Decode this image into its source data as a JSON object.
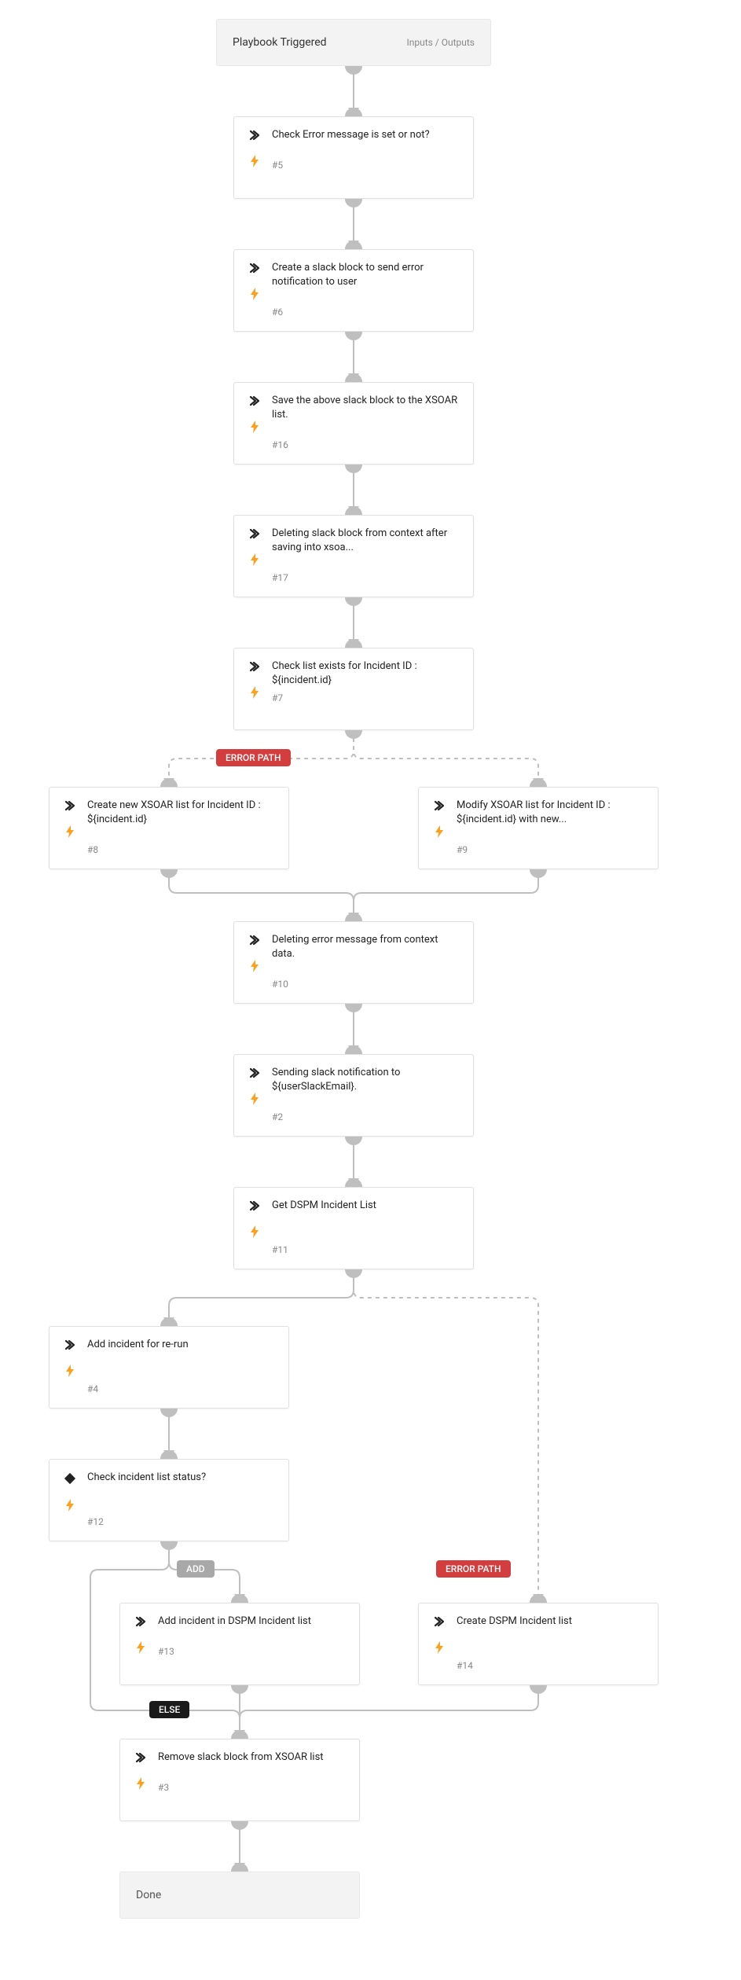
{
  "header": {
    "title": "Playbook Triggered",
    "io": "Inputs / Outputs"
  },
  "labels": {
    "error_path": "ERROR PATH",
    "add": "ADD",
    "else": "ELSE"
  },
  "done": "Done",
  "nodes": {
    "n5": {
      "title": "Check Error message is set or not?",
      "num": "#5"
    },
    "n6": {
      "title": "Create a slack block to send error notification to user",
      "num": "#6"
    },
    "n16": {
      "title": "Save the above slack block to the XSOAR list.",
      "num": "#16"
    },
    "n17": {
      "title": "Deleting slack block from context after saving into xsoa...",
      "num": "#17"
    },
    "n7": {
      "title": "Check list exists for Incident ID : ${incident.id}",
      "num": "#7"
    },
    "n8": {
      "title": "Create new XSOAR list for Incident ID : ${incident.id}",
      "num": "#8"
    },
    "n9": {
      "title": "Modify XSOAR list for Incident ID : ${incident.id} with new...",
      "num": "#9"
    },
    "n10": {
      "title": "Deleting error message from context data.",
      "num": "#10"
    },
    "n2": {
      "title": "Sending slack notification to ${userSlackEmail}.",
      "num": "#2"
    },
    "n11": {
      "title": "Get DSPM Incident List",
      "num": "#11"
    },
    "n4": {
      "title": "Add incident for re-run",
      "num": "#4"
    },
    "n12": {
      "title": "Check incident list status?",
      "num": "#12"
    },
    "n13": {
      "title": "Add incident in DSPM Incident list",
      "num": "#13"
    },
    "n14": {
      "title": "Create DSPM Incident list",
      "num": "#14"
    },
    "n3": {
      "title": "Remove slack block from XSOAR list",
      "num": "#3"
    }
  },
  "chart_data": {
    "type": "flowchart",
    "start": "header",
    "end": "done",
    "nodes": [
      {
        "id": "header",
        "label": "Playbook Triggered",
        "kind": "start"
      },
      {
        "id": "n5",
        "label": "Check Error message is set or not?",
        "task": "#5",
        "kind": "task"
      },
      {
        "id": "n6",
        "label": "Create a slack block to send error notification to user",
        "task": "#6",
        "kind": "task"
      },
      {
        "id": "n16",
        "label": "Save the above slack block to the XSOAR list.",
        "task": "#16",
        "kind": "task"
      },
      {
        "id": "n17",
        "label": "Deleting slack block from context after saving into xsoa...",
        "task": "#17",
        "kind": "task"
      },
      {
        "id": "n7",
        "label": "Check list exists for Incident ID : ${incident.id}",
        "task": "#7",
        "kind": "task"
      },
      {
        "id": "n8",
        "label": "Create new XSOAR list for Incident ID : ${incident.id}",
        "task": "#8",
        "kind": "task"
      },
      {
        "id": "n9",
        "label": "Modify XSOAR list for Incident ID : ${incident.id} with new...",
        "task": "#9",
        "kind": "task"
      },
      {
        "id": "n10",
        "label": "Deleting error message from context data.",
        "task": "#10",
        "kind": "task"
      },
      {
        "id": "n2",
        "label": "Sending slack notification to ${userSlackEmail}.",
        "task": "#2",
        "kind": "task"
      },
      {
        "id": "n11",
        "label": "Get DSPM Incident List",
        "task": "#11",
        "kind": "task"
      },
      {
        "id": "n4",
        "label": "Add incident for re-run",
        "task": "#4",
        "kind": "task"
      },
      {
        "id": "n12",
        "label": "Check incident list status?",
        "task": "#12",
        "kind": "condition"
      },
      {
        "id": "n13",
        "label": "Add incident in DSPM Incident list",
        "task": "#13",
        "kind": "task"
      },
      {
        "id": "n14",
        "label": "Create DSPM Incident list",
        "task": "#14",
        "kind": "task"
      },
      {
        "id": "n3",
        "label": "Remove slack block from XSOAR list",
        "task": "#3",
        "kind": "task"
      },
      {
        "id": "done",
        "label": "Done",
        "kind": "end"
      }
    ],
    "edges": [
      {
        "from": "header",
        "to": "n5"
      },
      {
        "from": "n5",
        "to": "n6"
      },
      {
        "from": "n6",
        "to": "n16"
      },
      {
        "from": "n16",
        "to": "n17"
      },
      {
        "from": "n17",
        "to": "n7"
      },
      {
        "from": "n7",
        "to": "n8",
        "label": "ERROR PATH",
        "style": "dashed"
      },
      {
        "from": "n7",
        "to": "n9",
        "style": "dashed"
      },
      {
        "from": "n8",
        "to": "n10"
      },
      {
        "from": "n9",
        "to": "n10"
      },
      {
        "from": "n10",
        "to": "n2"
      },
      {
        "from": "n2",
        "to": "n11"
      },
      {
        "from": "n11",
        "to": "n4"
      },
      {
        "from": "n11",
        "to": "n14",
        "label": "ERROR PATH",
        "style": "dashed"
      },
      {
        "from": "n4",
        "to": "n12"
      },
      {
        "from": "n12",
        "to": "n13",
        "label": "ADD"
      },
      {
        "from": "n12",
        "to": "n3",
        "label": "ELSE"
      },
      {
        "from": "n13",
        "to": "n3"
      },
      {
        "from": "n14",
        "to": "n3"
      },
      {
        "from": "n3",
        "to": "done"
      }
    ]
  }
}
